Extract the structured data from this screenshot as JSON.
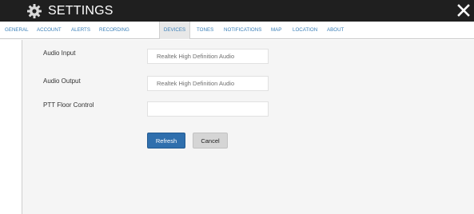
{
  "window": {
    "title": "SETTINGS",
    "icon": "gear-icon",
    "close_icon": "close-icon"
  },
  "tabs": [
    {
      "label": "GENERAL",
      "active": false
    },
    {
      "label": "ACCOUNT",
      "active": false
    },
    {
      "label": "ALERTS",
      "active": false
    },
    {
      "label": "RECORDING",
      "active": false
    },
    {
      "label": "DEVICES",
      "active": true
    },
    {
      "label": "TONES",
      "active": false
    },
    {
      "label": "NOTIFICATIONS",
      "active": false
    },
    {
      "label": "MAP",
      "active": false
    },
    {
      "label": "LOCATION",
      "active": false
    },
    {
      "label": "ABOUT",
      "active": false
    }
  ],
  "devices": {
    "audio_input": {
      "label": "Audio Input",
      "value": "Realtek High Definition Audio"
    },
    "audio_output": {
      "label": "Audio Output",
      "value": "Realtek High Definition Audio"
    },
    "ptt_floor_control": {
      "label": "PTT Floor Control",
      "value": ""
    }
  },
  "buttons": {
    "refresh": "Refresh",
    "cancel": "Cancel"
  },
  "colors": {
    "titlebar": "#1f1f1f",
    "tab_text": "#3a7fb8",
    "primary_button": "#2f6fad",
    "secondary_button": "#d5d5d5",
    "content_bg": "#f5f5f5"
  }
}
